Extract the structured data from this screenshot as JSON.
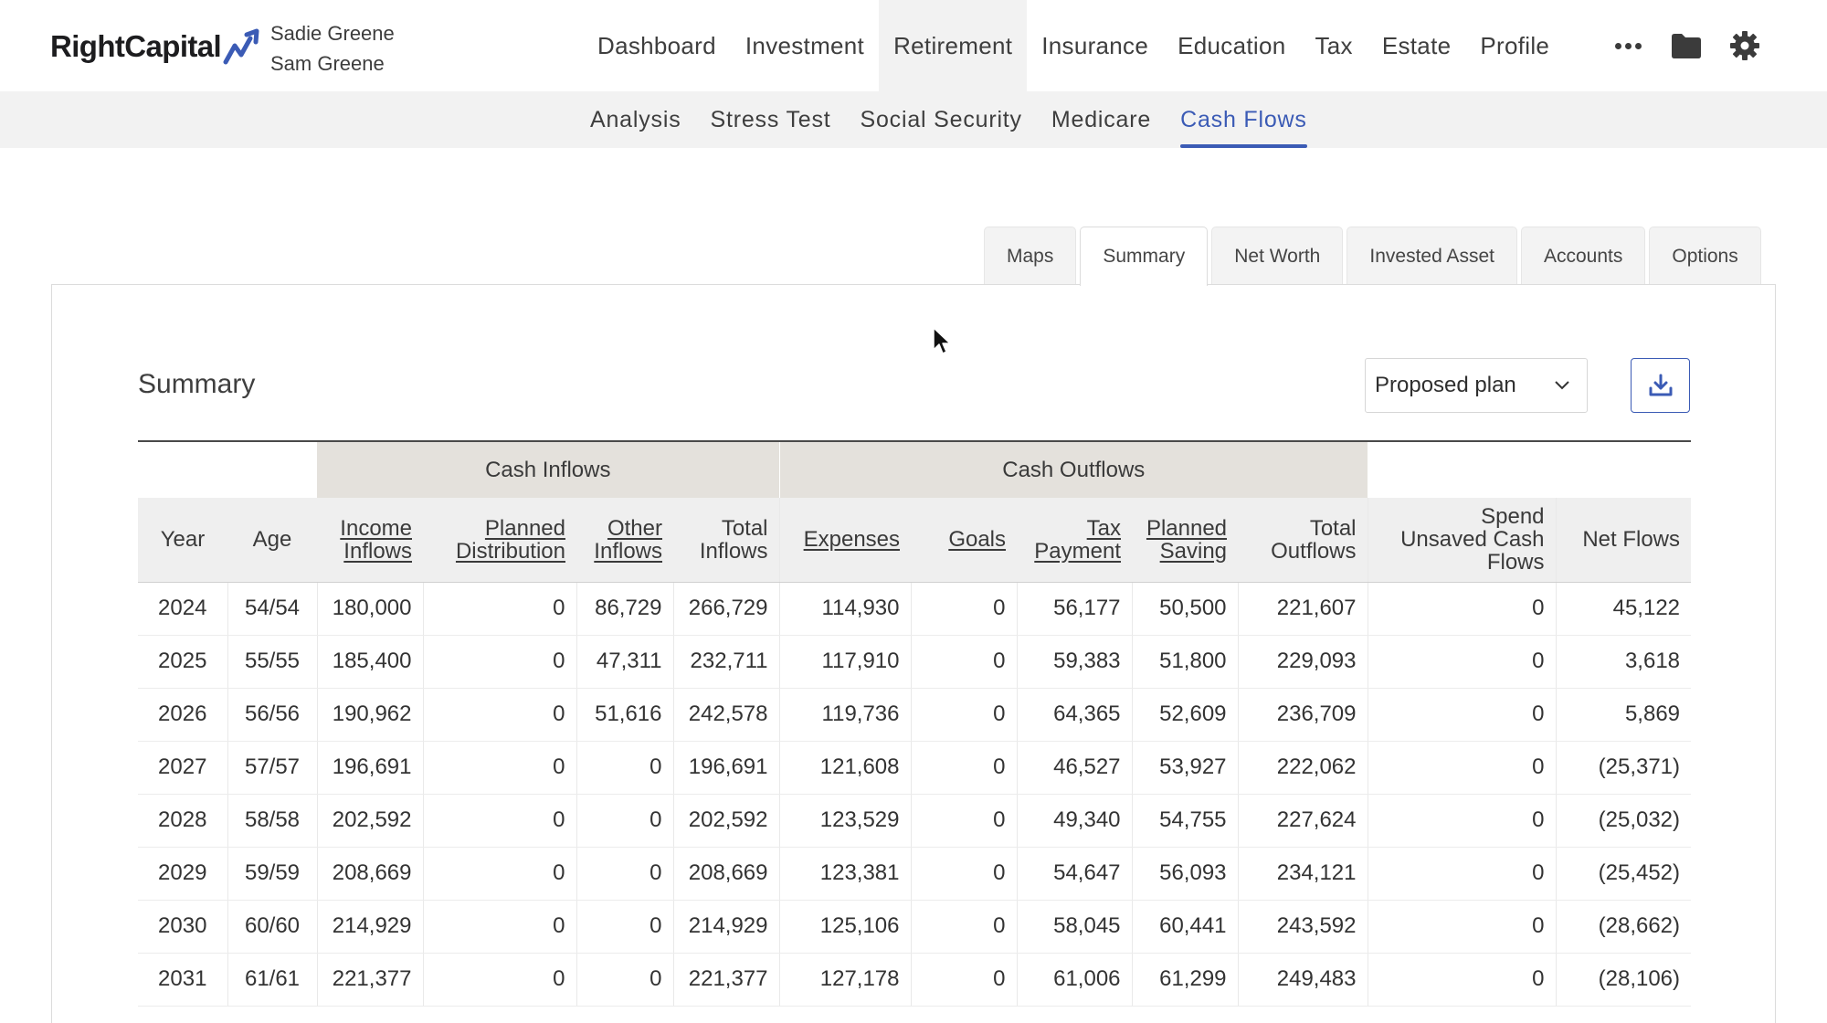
{
  "app": {
    "logo_text": "RightCapital",
    "clients": [
      "Sadie Greene",
      "Sam Greene"
    ]
  },
  "main_nav": [
    {
      "label": "Dashboard",
      "active": false
    },
    {
      "label": "Investment",
      "active": false
    },
    {
      "label": "Retirement",
      "active": true
    },
    {
      "label": "Insurance",
      "active": false
    },
    {
      "label": "Education",
      "active": false
    },
    {
      "label": "Tax",
      "active": false
    },
    {
      "label": "Estate",
      "active": false
    },
    {
      "label": "Profile",
      "active": false
    }
  ],
  "nav_icons": [
    "more-icon",
    "folder-icon",
    "gear-icon"
  ],
  "sub_nav": [
    {
      "label": "Analysis",
      "active": false
    },
    {
      "label": "Stress Test",
      "active": false
    },
    {
      "label": "Social Security",
      "active": false
    },
    {
      "label": "Medicare",
      "active": false
    },
    {
      "label": "Cash Flows",
      "active": true
    }
  ],
  "tabs": [
    {
      "label": "Maps",
      "active": false
    },
    {
      "label": "Summary",
      "active": true
    },
    {
      "label": "Net Worth",
      "active": false
    },
    {
      "label": "Invested Asset",
      "active": false
    },
    {
      "label": "Accounts",
      "active": false
    },
    {
      "label": "Options",
      "active": false
    }
  ],
  "summary": {
    "title": "Summary",
    "plan_select": "Proposed plan",
    "group_headers": {
      "inflows": "Cash Inflows",
      "outflows": "Cash Outflows"
    },
    "columns": [
      {
        "lines": [
          "Year"
        ],
        "link": false
      },
      {
        "lines": [
          "Age"
        ],
        "link": false
      },
      {
        "lines": [
          "Income",
          "Inflows"
        ],
        "link": true
      },
      {
        "lines": [
          "Planned",
          "Distribution"
        ],
        "link": true
      },
      {
        "lines": [
          "Other",
          "Inflows"
        ],
        "link": true
      },
      {
        "lines": [
          "Total",
          "Inflows"
        ],
        "link": false
      },
      {
        "lines": [
          "Expenses"
        ],
        "link": true
      },
      {
        "lines": [
          "Goals"
        ],
        "link": true
      },
      {
        "lines": [
          "Tax",
          "Payment"
        ],
        "link": true
      },
      {
        "lines": [
          "Planned",
          "Saving"
        ],
        "link": true
      },
      {
        "lines": [
          "Total",
          "Outflows"
        ],
        "link": false
      },
      {
        "lines": [
          "Spend",
          "Unsaved Cash",
          "Flows"
        ],
        "link": false
      },
      {
        "lines": [
          "Net Flows"
        ],
        "link": false
      }
    ],
    "rows": [
      [
        "2024",
        "54/54",
        "180,000",
        "0",
        "86,729",
        "266,729",
        "114,930",
        "0",
        "56,177",
        "50,500",
        "221,607",
        "0",
        "45,122"
      ],
      [
        "2025",
        "55/55",
        "185,400",
        "0",
        "47,311",
        "232,711",
        "117,910",
        "0",
        "59,383",
        "51,800",
        "229,093",
        "0",
        "3,618"
      ],
      [
        "2026",
        "56/56",
        "190,962",
        "0",
        "51,616",
        "242,578",
        "119,736",
        "0",
        "64,365",
        "52,609",
        "236,709",
        "0",
        "5,869"
      ],
      [
        "2027",
        "57/57",
        "196,691",
        "0",
        "0",
        "196,691",
        "121,608",
        "0",
        "46,527",
        "53,927",
        "222,062",
        "0",
        "(25,371)"
      ],
      [
        "2028",
        "58/58",
        "202,592",
        "0",
        "0",
        "202,592",
        "123,529",
        "0",
        "49,340",
        "54,755",
        "227,624",
        "0",
        "(25,032)"
      ],
      [
        "2029",
        "59/59",
        "208,669",
        "0",
        "0",
        "208,669",
        "123,381",
        "0",
        "54,647",
        "56,093",
        "234,121",
        "0",
        "(25,452)"
      ],
      [
        "2030",
        "60/60",
        "214,929",
        "0",
        "0",
        "214,929",
        "125,106",
        "0",
        "58,045",
        "60,441",
        "243,592",
        "0",
        "(28,662)"
      ],
      [
        "2031",
        "61/61",
        "221,377",
        "0",
        "0",
        "221,377",
        "127,178",
        "0",
        "61,006",
        "61,299",
        "249,483",
        "0",
        "(28,106)"
      ]
    ]
  },
  "colors": {
    "accent": "#3b5bb5",
    "group_header_bg": "#e4e1dc",
    "col_header_bg": "#efefef",
    "subnav_bg": "#f2f2f2"
  }
}
